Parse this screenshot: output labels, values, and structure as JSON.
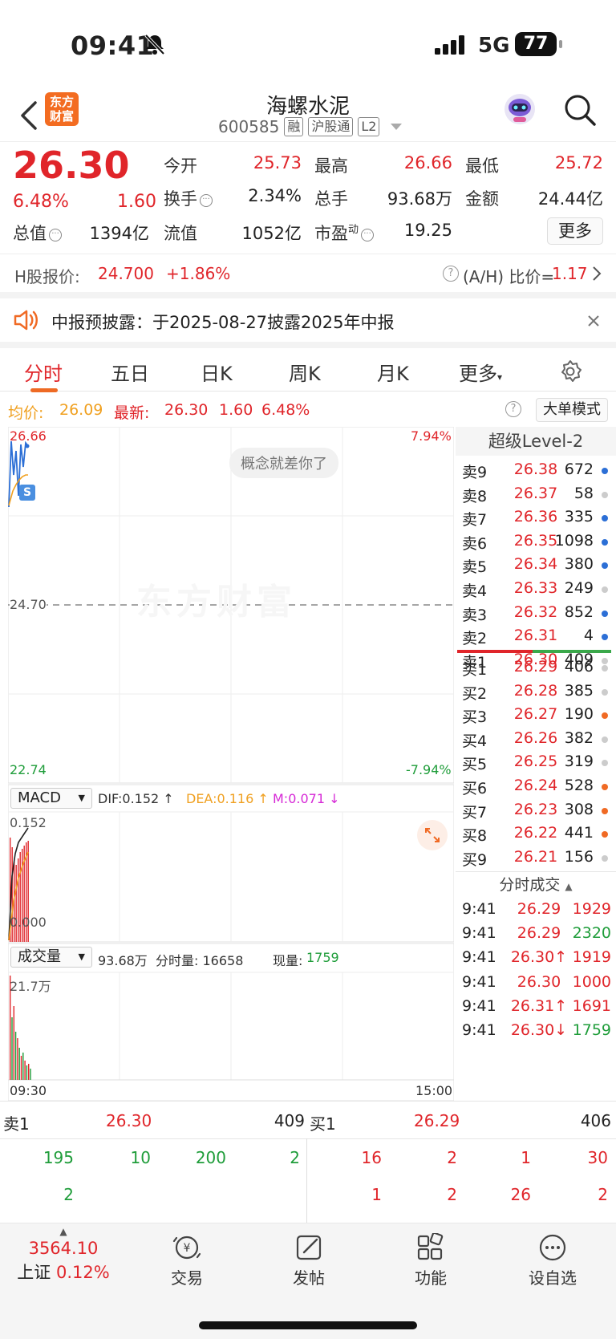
{
  "status_bar": {
    "time": "09:41",
    "network": "5G",
    "battery": "77"
  },
  "header": {
    "logo_text": "东方财富",
    "stock_name": "海螺水泥",
    "stock_code": "600585",
    "tags": [
      "融",
      "沪股通",
      "L2"
    ]
  },
  "quote": {
    "price": "26.30",
    "change_pct": "6.48%",
    "change": "1.60",
    "fields": [
      {
        "label": "今开",
        "value": "25.73",
        "color": "red"
      },
      {
        "label": "最高",
        "value": "26.66",
        "color": "red"
      },
      {
        "label": "最低",
        "value": "25.72",
        "color": "red"
      },
      {
        "label": "换手",
        "value": "2.34%",
        "color": "dark"
      },
      {
        "label": "总手",
        "value": "93.68万",
        "color": "dark"
      },
      {
        "label": "金额",
        "value": "24.44亿",
        "color": "dark"
      },
      {
        "label": "总值",
        "value": "1394亿",
        "color": "dark"
      },
      {
        "label": "流值",
        "value": "1052亿",
        "color": "dark"
      },
      {
        "label": "市盈",
        "value": "19.25",
        "color": "dark"
      }
    ],
    "pe_superscript": "动",
    "more_label": "更多"
  },
  "h_share": {
    "label": "H股报价:",
    "price": "24.700",
    "change": "+1.86%",
    "ratio_label": "(A/H) 比价=",
    "ratio_value": "1.17"
  },
  "notice": {
    "text": "中报预披露：于2025-08-27披露2025年中报"
  },
  "tabs": [
    "分时",
    "五日",
    "日K",
    "周K",
    "月K",
    "更多"
  ],
  "avg_row": {
    "avg_label": "均价:",
    "avg_value": "26.09",
    "latest_label": "最新:",
    "latest_price": "26.30",
    "latest_change": "1.60",
    "latest_pct": "6.48%",
    "mode_label": "大单模式"
  },
  "chart": {
    "top_price": "26.66",
    "top_pct": "7.94%",
    "mid_price": "24.70",
    "low_price": "22.74",
    "low_pct": "-7.94%",
    "badge": "概念就差你了",
    "watermark": "东方财富",
    "s_marker": "S",
    "macd_label": "MACD",
    "dif": "DIF:0.152 ↑",
    "dea": "DEA:0.116 ↑",
    "m": "M:0.071 ↓",
    "macd_top": "0.152",
    "macd_bottom": "0.000",
    "vol_label": "成交量",
    "vol_total": "93.68万",
    "vol_minute": "分时量: 16658",
    "vol_now_label": "现量:",
    "vol_now": "1759",
    "vol_top": "21.7万",
    "time_start": "09:30",
    "time_end": "15:00"
  },
  "chart_data": {
    "type": "line",
    "x_range": [
      "09:30",
      "15:00"
    ],
    "ylim": [
      22.74,
      26.66
    ],
    "prev_close": 24.7,
    "pct_range": [
      -7.94,
      7.94
    ],
    "series": [],
    "macd": {
      "dif": 0.152,
      "dea": 0.116,
      "m": 0.071,
      "ylim": [
        0.0,
        0.152
      ]
    },
    "volume": {
      "total": "93.68万",
      "minute": 16658,
      "current": 1759,
      "max_label": "21.7万"
    }
  },
  "level2": {
    "title": "超级Level-2",
    "asks": [
      {
        "label": "卖9",
        "price": "26.38",
        "vol": "672",
        "dot": "#2c6fd6"
      },
      {
        "label": "卖8",
        "price": "26.37",
        "vol": "58",
        "dot": "#cccccc"
      },
      {
        "label": "卖7",
        "price": "26.36",
        "vol": "335",
        "dot": "#2c6fd6"
      },
      {
        "label": "卖6",
        "price": "26.35",
        "vol": "1098",
        "dot": "#2c6fd6"
      },
      {
        "label": "卖5",
        "price": "26.34",
        "vol": "380",
        "dot": "#2c6fd6"
      },
      {
        "label": "卖4",
        "price": "26.33",
        "vol": "249",
        "dot": "#cccccc"
      },
      {
        "label": "卖3",
        "price": "26.32",
        "vol": "852",
        "dot": "#2c6fd6"
      },
      {
        "label": "卖2",
        "price": "26.31",
        "vol": "4",
        "dot": "#2c6fd6"
      },
      {
        "label": "卖1",
        "price": "26.30",
        "vol": "409",
        "dot": "#cccccc"
      }
    ],
    "bids": [
      {
        "label": "买1",
        "price": "26.29",
        "vol": "406",
        "dot": "#cccccc"
      },
      {
        "label": "买2",
        "price": "26.28",
        "vol": "385",
        "dot": "#cccccc"
      },
      {
        "label": "买3",
        "price": "26.27",
        "vol": "190",
        "dot": "#f06a24"
      },
      {
        "label": "买4",
        "price": "26.26",
        "vol": "382",
        "dot": "#cccccc"
      },
      {
        "label": "买5",
        "price": "26.25",
        "vol": "319",
        "dot": "#cccccc"
      },
      {
        "label": "买6",
        "price": "26.24",
        "vol": "528",
        "dot": "#f06a24"
      },
      {
        "label": "买7",
        "price": "26.23",
        "vol": "308",
        "dot": "#f06a24"
      },
      {
        "label": "买8",
        "price": "26.22",
        "vol": "441",
        "dot": "#f06a24"
      },
      {
        "label": "买9",
        "price": "26.21",
        "vol": "156",
        "dot": "#cccccc"
      }
    ],
    "ticks_title": "分时成交",
    "ticks": [
      {
        "time": "9:41",
        "price": "26.29",
        "vol": "1929",
        "vol_color": "red"
      },
      {
        "time": "9:41",
        "price": "26.29",
        "vol": "2320",
        "vol_color": "green"
      },
      {
        "time": "9:41",
        "price": "26.30↑",
        "vol": "1919",
        "vol_color": "red"
      },
      {
        "time": "9:41",
        "price": "26.30",
        "vol": "1000",
        "vol_color": "red"
      },
      {
        "time": "9:41",
        "price": "26.31↑",
        "vol": "1691",
        "vol_color": "red"
      },
      {
        "time": "9:41",
        "price": "26.30↓",
        "vol": "1759",
        "vol_color": "green"
      }
    ]
  },
  "bottom": {
    "ask_label": "卖1",
    "ask_price": "26.30",
    "ask_vol": "409",
    "bid_label": "买1",
    "bid_price": "26.29",
    "bid_vol": "406",
    "ask_queue_row1": [
      "195",
      "10",
      "200",
      "2"
    ],
    "ask_queue_row2": [
      "2"
    ],
    "bid_queue_row1": [
      "16",
      "2",
      "1",
      "30"
    ],
    "bid_queue_row2": [
      "1",
      "2",
      "26",
      "2"
    ]
  },
  "navbar": {
    "index_value": "3564.10",
    "index_name": "上证",
    "index_pct": "0.12%",
    "items": [
      "交易",
      "发帖",
      "功能",
      "设自选"
    ]
  }
}
